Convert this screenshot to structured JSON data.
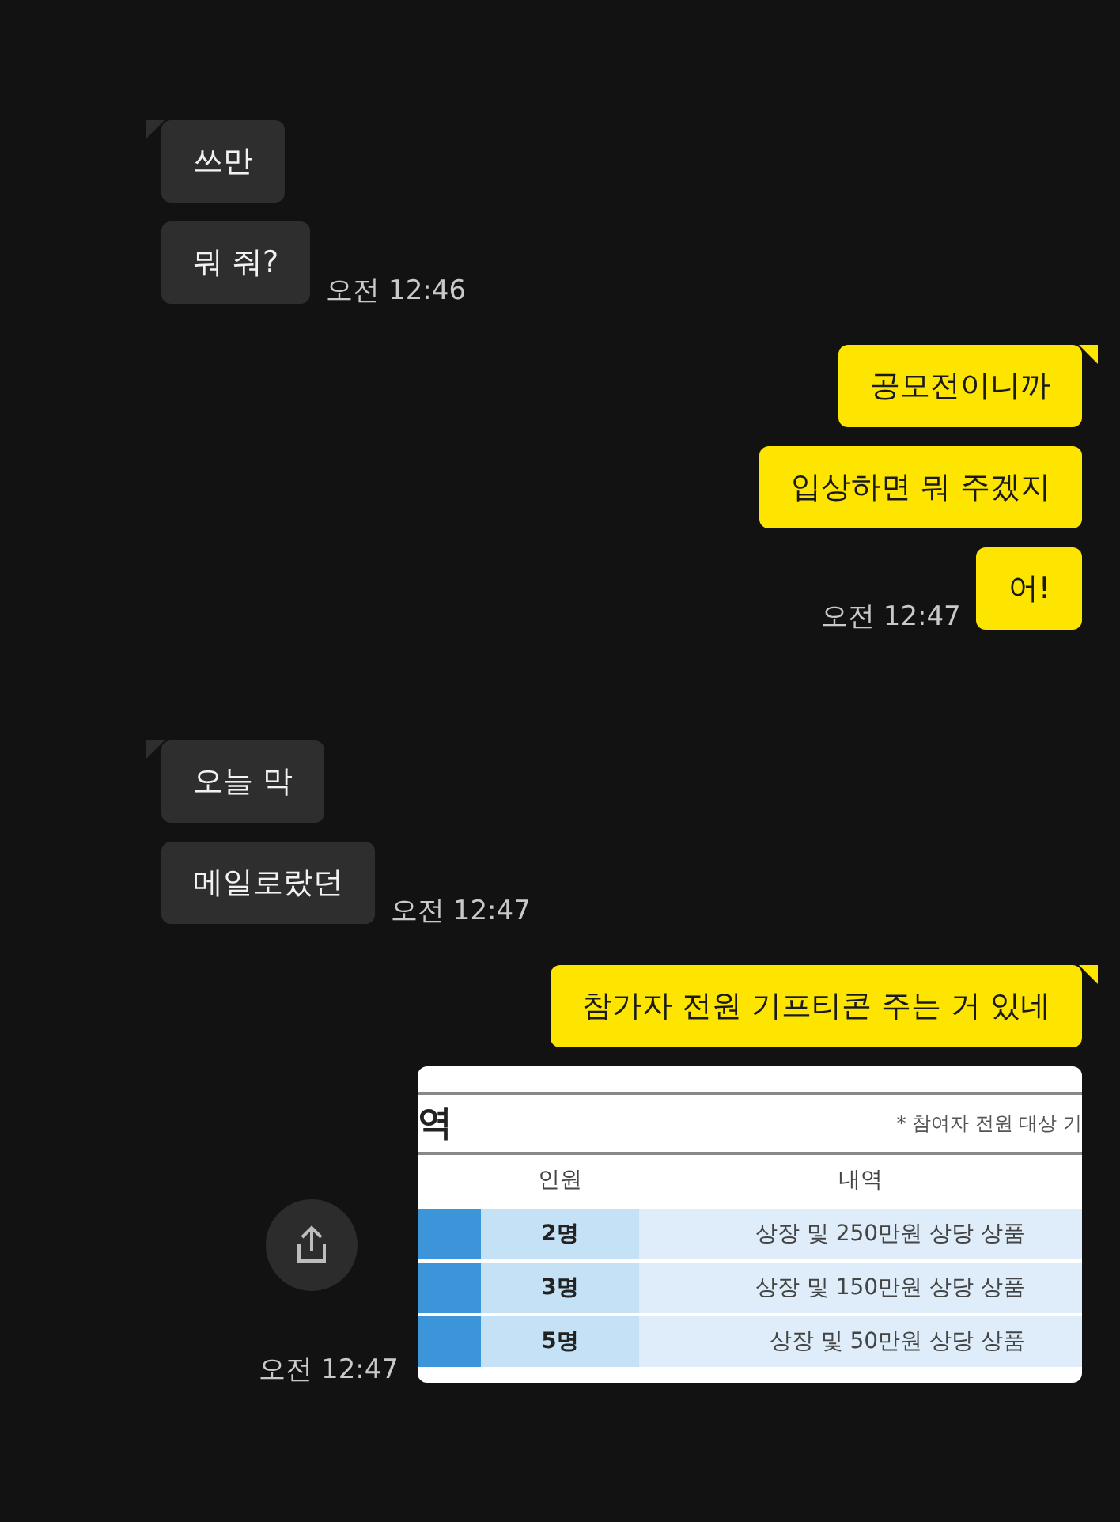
{
  "messages": [
    {
      "kind": "received_text",
      "tail": true,
      "text": "쓰만"
    },
    {
      "kind": "received_text",
      "tail": false,
      "text": "뭐 줘?",
      "time": "오전 12:46"
    },
    {
      "kind": "sent_text",
      "tail": true,
      "text": "공모전이니까"
    },
    {
      "kind": "sent_text",
      "tail": false,
      "text": "입상하면 뭐 주겠지"
    },
    {
      "kind": "sent_text",
      "tail": false,
      "text": "어!",
      "time": "오전 12:47"
    },
    {
      "kind": "received_text",
      "tail": true,
      "text": "오늘 막"
    },
    {
      "kind": "received_text",
      "tail": false,
      "text": "메일로랐던",
      "time": "오전 12:47"
    },
    {
      "kind": "sent_text",
      "tail": true,
      "text": "참가자 전원 기프티콘 주는 거 있네"
    },
    {
      "kind": "sent_image",
      "time": "오전 12:47",
      "document": {
        "title": "역",
        "note": "* 참여자 전원 대상 기",
        "columns": [
          "인원",
          "내역"
        ],
        "rows": [
          {
            "count": "2명",
            "detail": "상장 및 250만원 상당 상품"
          },
          {
            "count": "3명",
            "detail": "상장 및 150만원 상당 상품"
          },
          {
            "count": "5명",
            "detail": "상장 및 50만원 상당 상품"
          }
        ]
      }
    }
  ]
}
